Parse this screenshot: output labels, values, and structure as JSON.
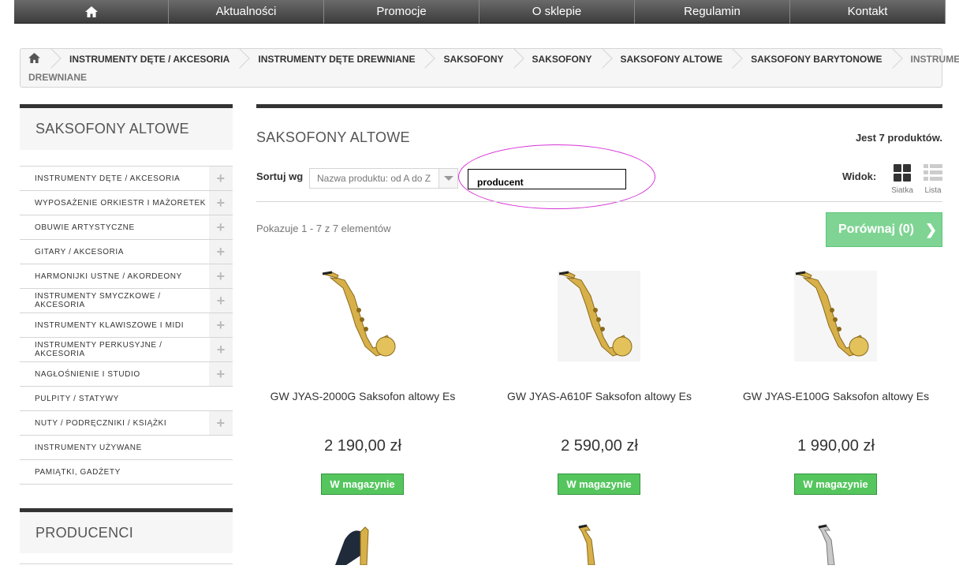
{
  "topnav": {
    "home_icon": "home-icon",
    "items": [
      "Aktualności",
      "Promocje",
      "O sklepie",
      "Regulamin",
      "Kontakt"
    ]
  },
  "breadcrumb": {
    "home_icon": "home-icon",
    "items": [
      "INSTRUMENTY DĘTE / AKCESORIA",
      "INSTRUMENTY DĘTE DREWNIANE",
      "SAKSOFONY",
      "SAKSOFONY",
      "SAKSOFONY ALTOWE",
      "SAKSOFONY BARYTONOWE"
    ],
    "current_line1": "INSTRUMENTY DĘTE",
    "current_line2": "DREWNIANE"
  },
  "sidebar": {
    "title": "SAKSOFONY ALTOWE",
    "categories": [
      {
        "label": "INSTRUMENTY DĘTE / AKCESORIA",
        "expandable": true
      },
      {
        "label": "WYPOSAŻENIE ORKIESTR I MAŻORETEK",
        "expandable": true
      },
      {
        "label": "OBUWIE ARTYSTYCZNE",
        "expandable": true
      },
      {
        "label": "GITARY / AKCESORIA",
        "expandable": true
      },
      {
        "label": "HARMONIJKI USTNE / AKORDEONY",
        "expandable": true
      },
      {
        "label": "INSTRUMENTY SMYCZKOWE / AKCESORIA",
        "expandable": true
      },
      {
        "label": "INSTRUMENTY KLAWISZOWE I MIDI",
        "expandable": true
      },
      {
        "label": "INSTRUMENTY PERKUSYJNE / AKCESORIA",
        "expandable": true
      },
      {
        "label": "NAGŁOŚNIENIE I STUDIO",
        "expandable": true
      },
      {
        "label": "PULPITY / STATYWY",
        "expandable": false
      },
      {
        "label": "NUTY / PODRĘCZNIKI / KSIĄŻKI",
        "expandable": true
      },
      {
        "label": "INSTRUMENTY UŻYWANE",
        "expandable": false
      },
      {
        "label": "PAMIĄTKI, GADŻETY",
        "expandable": false
      }
    ],
    "producers_title": "PRODUCENCI"
  },
  "main": {
    "title": "SAKSOFONY ALTOWE",
    "product_count": "Jest 7 produktów.",
    "sort_label": "Sortuj wg",
    "sort_value": "Nazwa produktu: od A do Z",
    "producer_input": "producent",
    "view_label": "Widok:",
    "view_grid": "Siatka",
    "view_list": "Lista",
    "showing": "Pokazuje 1 - 7 z 7 elementów",
    "compare_button": "Porównaj (0)"
  },
  "products": [
    {
      "name": "GW JYAS-2000G Saksofon altowy Es",
      "price": "2 190,00 zł",
      "stock": "W magazynie"
    },
    {
      "name": "GW JYAS-A610F Saksofon altowy Es",
      "price": "2 590,00 zł",
      "stock": "W magazynie"
    },
    {
      "name": "GW JYAS-E100G Saksofon altowy Es",
      "price": "1 990,00 zł",
      "stock": "W magazynie"
    }
  ],
  "colors": {
    "accent_green": "#55c65e",
    "compare_green": "#7fd493",
    "highlight_ellipse": "#d633d6",
    "nav_dark": "#3c3c3c"
  }
}
